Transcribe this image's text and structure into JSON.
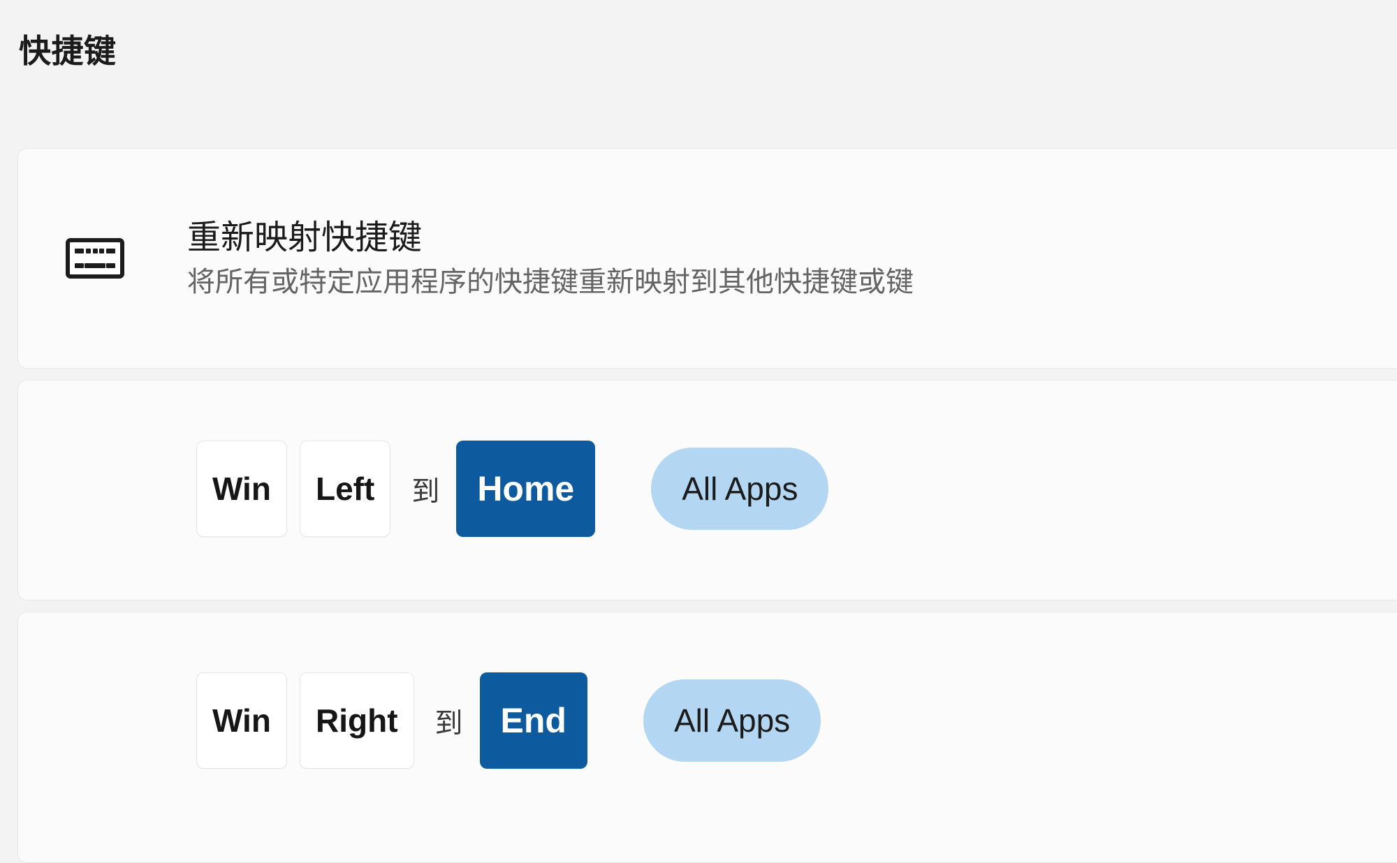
{
  "section": {
    "title": "快捷键"
  },
  "description_card": {
    "icon": "keyboard-icon",
    "title": "重新映射快捷键",
    "subtitle": "将所有或特定应用程序的快捷键重新映射到其他快捷键或键"
  },
  "mappings": [
    {
      "source_keys": [
        "Win",
        "Left"
      ],
      "separator": "到",
      "target_key": "Home",
      "scope": "All Apps"
    },
    {
      "source_keys": [
        "Win",
        "Right"
      ],
      "separator": "到",
      "target_key": "End",
      "scope": "All Apps"
    }
  ],
  "colors": {
    "page_background": "#f3f3f3",
    "card_background": "#fbfbfb",
    "card_border": "#e7e7e7",
    "target_accent": "#0d5a9e",
    "scope_accent": "#b3d6f2",
    "key_chip_background": "#ffffff",
    "title_text": "#1b1b1b",
    "subtitle_text": "#646464"
  }
}
